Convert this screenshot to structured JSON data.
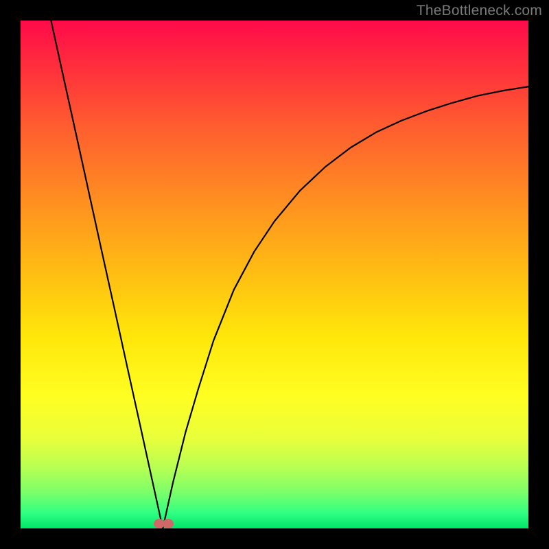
{
  "watermark": "TheBottleneck.com",
  "chart_data": {
    "type": "line",
    "title": "",
    "xlabel": "",
    "ylabel": "",
    "xlim": [
      0,
      1
    ],
    "ylim": [
      0,
      1
    ],
    "grid": false,
    "legend": false,
    "background": "rainbow-vertical-gradient",
    "series": [
      {
        "name": "left-branch",
        "x": [
          0.06,
          0.085,
          0.11,
          0.135,
          0.16,
          0.185,
          0.21,
          0.235,
          0.26,
          0.28
        ],
        "y": [
          1.0,
          0.886,
          0.773,
          0.659,
          0.545,
          0.432,
          0.318,
          0.205,
          0.091,
          0.0
        ],
        "stroke": "#000000"
      },
      {
        "name": "right-branch",
        "x": [
          0.28,
          0.3,
          0.325,
          0.35,
          0.38,
          0.42,
          0.46,
          0.5,
          0.55,
          0.6,
          0.65,
          0.7,
          0.75,
          0.8,
          0.85,
          0.9,
          0.95,
          1.0
        ],
        "y": [
          0.0,
          0.09,
          0.19,
          0.275,
          0.37,
          0.47,
          0.545,
          0.605,
          0.665,
          0.712,
          0.75,
          0.78,
          0.803,
          0.822,
          0.838,
          0.852,
          0.862,
          0.87
        ],
        "stroke": "#000000"
      }
    ],
    "markers": [
      {
        "name": "vertex-dot-a",
        "x": 0.273,
        "y": 0.01,
        "color": "#d06868"
      },
      {
        "name": "vertex-dot-b",
        "x": 0.29,
        "y": 0.01,
        "color": "#d06868"
      }
    ]
  }
}
